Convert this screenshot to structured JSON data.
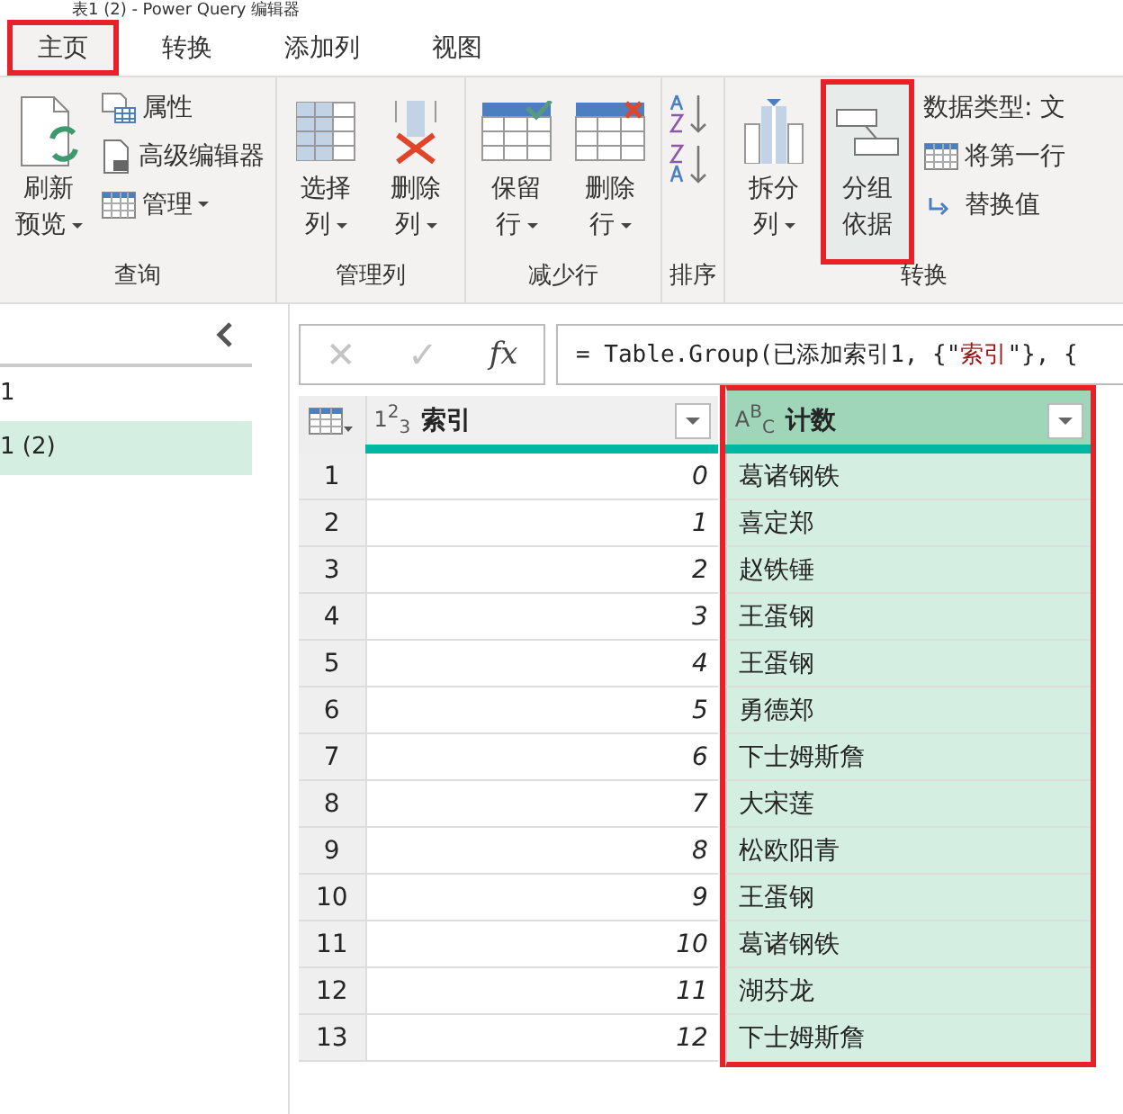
{
  "window": {
    "title": "表1 (2) - Power Query 编辑器"
  },
  "tabs": [
    {
      "label": "主页",
      "selected": true,
      "highlighted": true
    },
    {
      "label": "转换",
      "selected": false,
      "highlighted": false
    },
    {
      "label": "添加列",
      "selected": false,
      "highlighted": false
    },
    {
      "label": "视图",
      "selected": false,
      "highlighted": false
    }
  ],
  "ribbon_groups": [
    {
      "label": "查询",
      "items": [
        {
          "kind": "big",
          "lines": [
            "刷新",
            "预览"
          ],
          "dropdown": true,
          "highlighted": false
        },
        {
          "kind": "stack",
          "entries": [
            {
              "label": "属性",
              "dropdown": false
            },
            {
              "label": "高级编辑器",
              "dropdown": false
            },
            {
              "label": "管理",
              "dropdown": true
            }
          ]
        }
      ]
    },
    {
      "label": "管理列",
      "items": [
        {
          "kind": "big",
          "lines": [
            "选择",
            "列"
          ],
          "dropdown": true,
          "highlighted": false
        },
        {
          "kind": "big",
          "lines": [
            "删除",
            "列"
          ],
          "dropdown": true,
          "highlighted": false
        }
      ]
    },
    {
      "label": "减少行",
      "items": [
        {
          "kind": "big",
          "lines": [
            "保留",
            "行"
          ],
          "dropdown": true,
          "highlighted": false
        },
        {
          "kind": "big",
          "lines": [
            "删除",
            "行"
          ],
          "dropdown": true,
          "highlighted": false
        }
      ]
    },
    {
      "label": "排序",
      "items": [
        {
          "kind": "sort"
        }
      ]
    },
    {
      "label": "转换",
      "items": [
        {
          "kind": "big",
          "lines": [
            "拆分",
            "列"
          ],
          "dropdown": true,
          "highlighted": false
        },
        {
          "kind": "big",
          "lines": [
            "分组",
            "依据"
          ],
          "dropdown": false,
          "highlighted": true
        },
        {
          "kind": "stack",
          "entries": [
            {
              "label": "数据类型: 文",
              "dropdown": false
            },
            {
              "label": "将第一行",
              "dropdown": false
            },
            {
              "label": "替换值",
              "dropdown": false
            }
          ]
        }
      ]
    }
  ],
  "sidebar": {
    "items": [
      {
        "label": "1",
        "selected": false
      },
      {
        "label": "1 (2)",
        "selected": true
      }
    ]
  },
  "formula_bar": {
    "buttons": [
      {
        "kind": "cancel",
        "label": "✕",
        "disabled": true
      },
      {
        "kind": "commit",
        "label": "✓",
        "disabled": true
      },
      {
        "kind": "fx",
        "label": "fx",
        "disabled": false
      }
    ],
    "parts": [
      {
        "kind": "code",
        "text": "= Table.Group(已添加索引1, {\""
      },
      {
        "kind": "string",
        "text": "索引"
      },
      {
        "kind": "code",
        "text": "\"}, {"
      }
    ]
  },
  "table": {
    "columns": [
      {
        "type_icon": "1$^{2}$$_{3}$",
        "name": "索引",
        "selected": false,
        "highlighted": false
      },
      {
        "type_icon": "A$^{B}$$_{C}$",
        "name": "计数",
        "selected": true,
        "highlighted": true
      }
    ],
    "rows": [
      {
        "number": "1",
        "cells": [
          "0",
          "葛诸钢铁"
        ]
      },
      {
        "number": "2",
        "cells": [
          "1",
          "喜定郑"
        ]
      },
      {
        "number": "3",
        "cells": [
          "2",
          "赵铁锤"
        ]
      },
      {
        "number": "4",
        "cells": [
          "3",
          "王蛋钢"
        ]
      },
      {
        "number": "5",
        "cells": [
          "4",
          "王蛋钢"
        ]
      },
      {
        "number": "6",
        "cells": [
          "5",
          "勇德郑"
        ]
      },
      {
        "number": "7",
        "cells": [
          "6",
          "下士姆斯詹"
        ]
      },
      {
        "number": "8",
        "cells": [
          "7",
          "大宋莲"
        ]
      },
      {
        "number": "9",
        "cells": [
          "8",
          "松欧阳青"
        ]
      },
      {
        "number": "10",
        "cells": [
          "9",
          "王蛋钢"
        ]
      },
      {
        "number": "11",
        "cells": [
          "10",
          "葛诸钢铁"
        ]
      },
      {
        "number": "12",
        "cells": [
          "11",
          "湖芬龙"
        ]
      },
      {
        "number": "13",
        "cells": [
          "12",
          "下士姆斯詹"
        ]
      }
    ]
  }
}
